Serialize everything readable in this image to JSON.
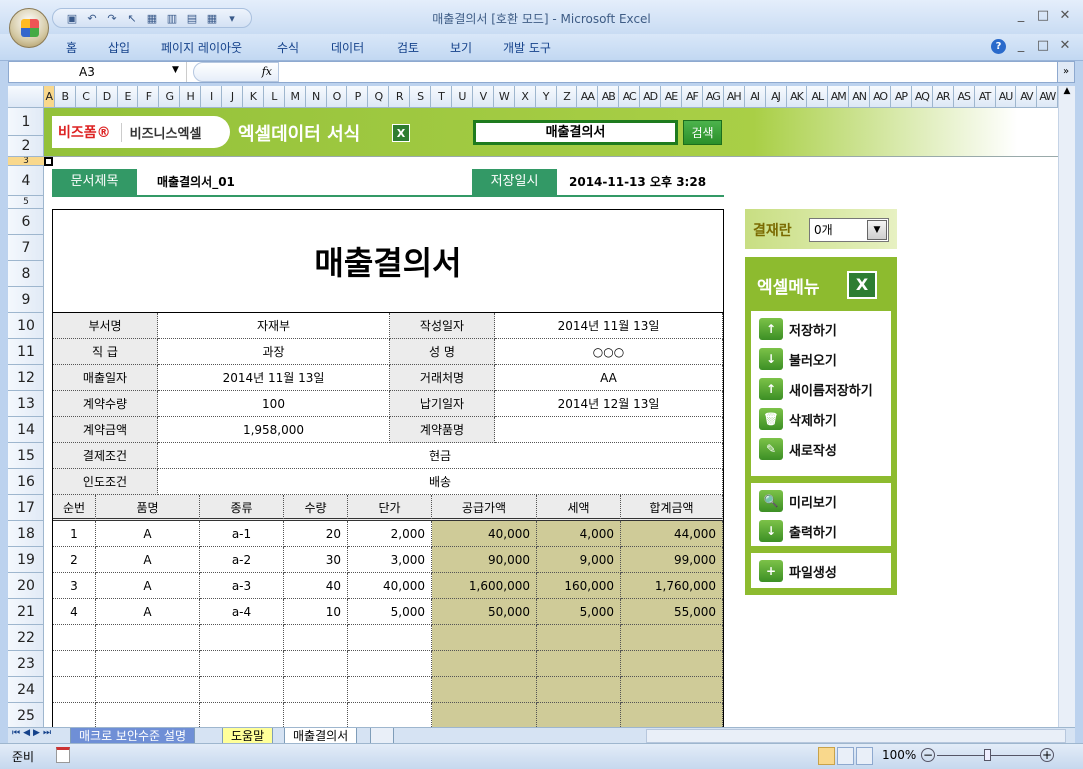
{
  "window": {
    "title": "매출결의서  [호환 모드] - Microsoft Excel",
    "min": "_",
    "max": "□",
    "close": "✕"
  },
  "ribbon": {
    "tabs": [
      "홈",
      "삽입",
      "페이지 레이아웃",
      "수식",
      "데이터",
      "검토",
      "보기",
      "개발 도구"
    ],
    "help": "?"
  },
  "formula_bar": {
    "name_box": "A3",
    "fx": "fx",
    "value": ""
  },
  "columns": [
    "A",
    "B",
    "C",
    "D",
    "E",
    "F",
    "G",
    "H",
    "I",
    "J",
    "K",
    "L",
    "M",
    "N",
    "O",
    "P",
    "Q",
    "R",
    "S",
    "T",
    "U",
    "V",
    "W",
    "X",
    "Y",
    "Z",
    "AA",
    "AB",
    "AC",
    "AD",
    "AE",
    "AF",
    "AG",
    "AH",
    "AI",
    "AJ",
    "AK",
    "AL",
    "AM",
    "AN",
    "AO",
    "AP",
    "AQ",
    "AR",
    "AS",
    "AT",
    "AU",
    "AV",
    "AW"
  ],
  "rows": [
    "1",
    "2",
    "3",
    "4",
    "5",
    "6",
    "7",
    "8",
    "9",
    "10",
    "11",
    "12",
    "13",
    "14",
    "15",
    "16",
    "17",
    "18",
    "19",
    "20",
    "21",
    "22",
    "23",
    "24",
    "25"
  ],
  "banner": {
    "logo_brand": "비즈폼®",
    "logo_sub": "비즈니스엑셀",
    "title": "엑셀데이터 서식",
    "search_value": "매출결의서",
    "search_button": "검색"
  },
  "doc": {
    "title_label": "문서제목",
    "title_value": "매출결의서_01",
    "saved_label": "저장일시",
    "saved_value": "2014-11-13  오후 3:28"
  },
  "form": {
    "title": "매출결의서",
    "info": [
      [
        "부서명",
        "자재부",
        "작성일자",
        "2014년 11월 13일"
      ],
      [
        "직   급",
        "과장",
        "성      명",
        "○○○"
      ],
      [
        "매출일자",
        "2014년 11월 13일",
        "거래처명",
        "AA"
      ],
      [
        "계약수량",
        "100",
        "납기일자",
        "2014년 12월 13일"
      ],
      [
        "계약금액",
        "1,958,000",
        "계약품명",
        ""
      ]
    ],
    "wide": [
      [
        "결제조건",
        "현금"
      ],
      [
        "인도조건",
        "배송"
      ]
    ],
    "item_headers": [
      "순번",
      "품명",
      "종류",
      "수량",
      "단가",
      "공급가액",
      "세액",
      "합계금액"
    ],
    "items": [
      [
        "1",
        "A",
        "a-1",
        "20",
        "2,000",
        "40,000",
        "4,000",
        "44,000"
      ],
      [
        "2",
        "A",
        "a-2",
        "30",
        "3,000",
        "90,000",
        "9,000",
        "99,000"
      ],
      [
        "3",
        "A",
        "a-3",
        "40",
        "40,000",
        "1,600,000",
        "160,000",
        "1,760,000"
      ],
      [
        "4",
        "A",
        "a-4",
        "10",
        "5,000",
        "50,000",
        "5,000",
        "55,000"
      ],
      [
        "",
        "",
        "",
        "",
        "",
        "",
        "",
        ""
      ],
      [
        "",
        "",
        "",
        "",
        "",
        "",
        "",
        ""
      ],
      [
        "",
        "",
        "",
        "",
        "",
        "",
        "",
        ""
      ],
      [
        "",
        "",
        "",
        "",
        "",
        "",
        "",
        ""
      ]
    ]
  },
  "approval": {
    "label": "결재란",
    "value": "0개"
  },
  "menu": {
    "title": "엑셀메뉴",
    "groups": [
      [
        {
          "label": "저장하기",
          "icon": "save-icon",
          "glyph": "↑"
        },
        {
          "label": "불러오기",
          "icon": "open-icon",
          "glyph": "↓"
        },
        {
          "label": "새이름저장하기",
          "icon": "save-as-icon",
          "glyph": "↑"
        },
        {
          "label": "삭제하기",
          "icon": "trash-icon",
          "glyph": "🗑"
        },
        {
          "label": "새로작성",
          "icon": "new-document-icon",
          "glyph": "✎"
        }
      ],
      [
        {
          "label": "미리보기",
          "icon": "preview-icon",
          "glyph": "🔍"
        },
        {
          "label": "출력하기",
          "icon": "print-icon",
          "glyph": "↓"
        }
      ],
      [
        {
          "label": "파일생성",
          "icon": "new-file-icon",
          "glyph": "+"
        }
      ]
    ]
  },
  "sheets": [
    {
      "label": "매크로 보안수준 설명",
      "color": "#6f8fd6"
    },
    {
      "label": "도움말",
      "color": "#ffff99"
    },
    {
      "label": "매출결의서",
      "color": "#ffffff"
    }
  ],
  "status": {
    "ready": "준비",
    "zoom": "100%"
  }
}
